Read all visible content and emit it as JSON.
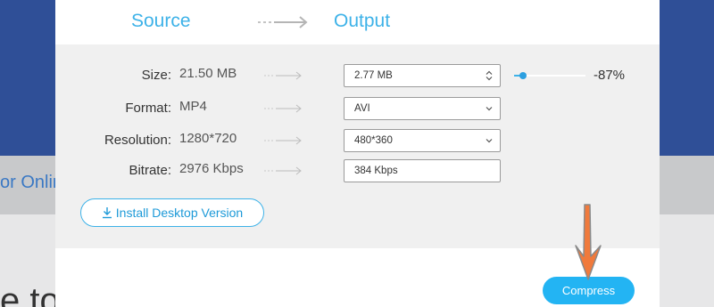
{
  "background": {
    "link_text": "or Online",
    "heading_text": "e to"
  },
  "dialog": {
    "source_label": "Source",
    "output_label": "Output",
    "rows": [
      {
        "label": "Size:",
        "source": "21.50 MB",
        "output": "2.77  MB",
        "control": "spinner"
      },
      {
        "label": "Format:",
        "source": "MP4",
        "output": "AVI",
        "control": "dropdown"
      },
      {
        "label": "Resolution:",
        "source": "1280*720",
        "output": "480*360",
        "control": "dropdown"
      },
      {
        "label": "Bitrate:",
        "source": "2976 Kbps",
        "output": "384 Kbps",
        "control": "none"
      }
    ],
    "size_slider": {
      "fraction": 0.13
    },
    "percent_text": "-87%",
    "install_button": "Install Desktop Version",
    "compress_button": "Compress"
  },
  "colors": {
    "accent": "#3db2e8",
    "compress_bg": "#23b4f3",
    "header_bg": "#2f4f97",
    "pointer_arrow": "#f07a3c"
  }
}
